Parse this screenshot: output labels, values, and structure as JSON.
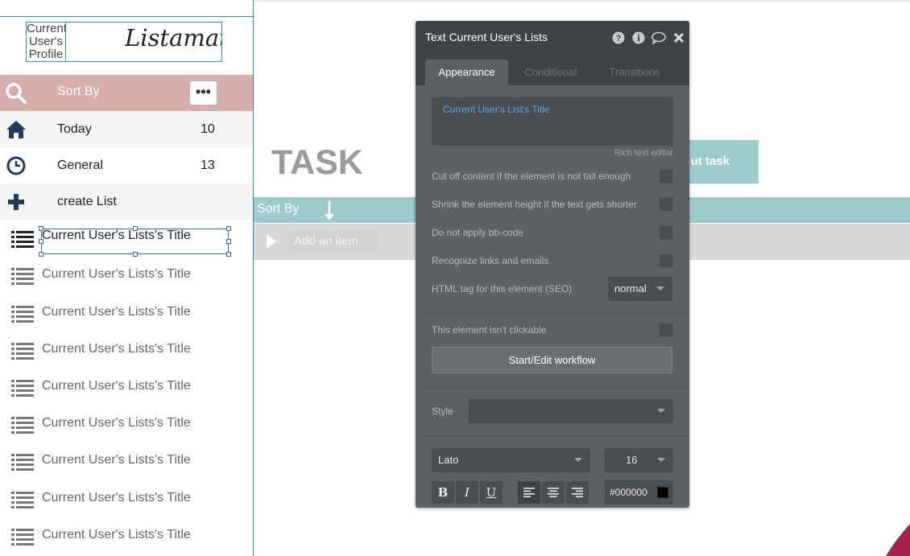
{
  "sidebar": {
    "profile_image_text": "Current User's Profile",
    "brand": "Listamatic",
    "sort_label": "Sort By",
    "more_label": "•••",
    "nav": [
      {
        "label": "Today",
        "count": "10"
      },
      {
        "label": "General",
        "count": "13"
      },
      {
        "label": "create List",
        "count": ""
      }
    ],
    "list_item_label": "Current User's Lists's Title",
    "list_items": [
      "Current User's Lists's Title",
      "Current User's Lists's Title",
      "Current User's Lists's Title",
      "Current User's Lists's Title",
      "Current User's Lists's Title",
      "Current User's Lists's Title",
      "Current User's Lists's Title",
      "Current User's Lists's Title",
      "Current User's Lists's Title"
    ]
  },
  "canvas": {
    "task_title": "TASK",
    "task_button": "ut task",
    "sort_label": "Sort By",
    "add_item": "Add an item"
  },
  "panel": {
    "title": "Text Current User's Lists",
    "tabs": [
      "Appearance",
      "Conditional",
      "Transitions"
    ],
    "rich_text_value": "Current User's List's Title",
    "rich_text_hint": "Rich text editor",
    "options": [
      "Cut off content if the element is not tall enough",
      "Shrink the element height if the text gets shorter",
      "Do not apply bb-code",
      "Recognize links and emails"
    ],
    "html_tag_label": "HTML tag for this element (SEO)",
    "html_tag_value": "normal",
    "not_clickable_label": "This element isn't clickable",
    "workflow_button": "Start/Edit workflow",
    "style_label": "Style",
    "style_value": "",
    "font_value": "Lato",
    "font_size_value": "16",
    "bold": "B",
    "italic": "I",
    "underline": "U",
    "color_value": "#000000"
  },
  "colors": {
    "sidebar_accent": "#d6aeac",
    "teal": "#9dcacb",
    "panel_bg": "#5d6166",
    "link_blue": "#58a8e8"
  }
}
